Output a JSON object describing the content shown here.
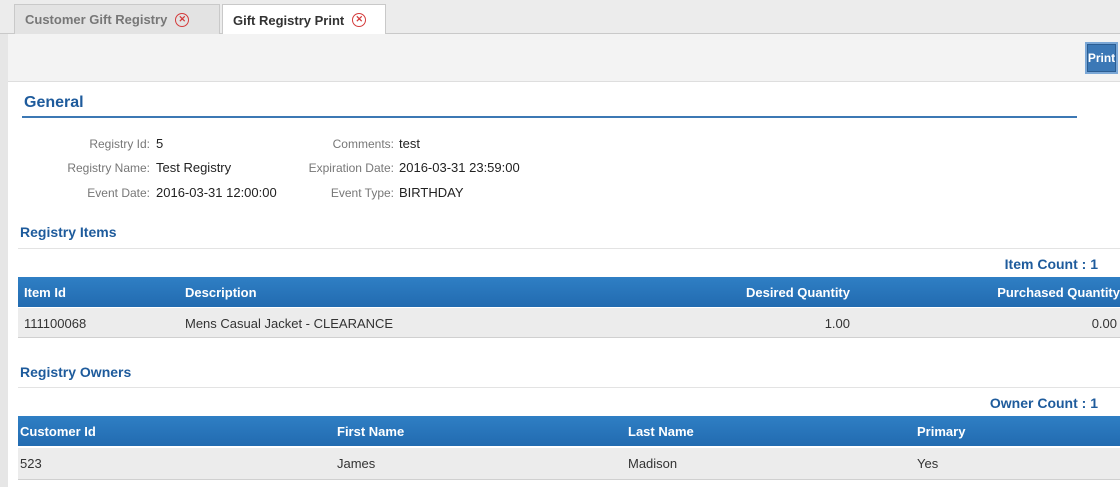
{
  "tabs": [
    {
      "label": "Customer Gift Registry",
      "active": false
    },
    {
      "label": "Gift Registry Print",
      "active": true
    }
  ],
  "toolbar": {
    "print_label": "Print"
  },
  "general": {
    "title": "General",
    "fields": {
      "registry_id": {
        "label": "Registry Id:",
        "value": "5"
      },
      "registry_name": {
        "label": "Registry Name:",
        "value": "Test Registry"
      },
      "event_date": {
        "label": "Event Date:",
        "value": "2016-03-31 12:00:00"
      },
      "comments": {
        "label": "Comments:",
        "value": "test"
      },
      "expiration_date": {
        "label": "Expiration Date:",
        "value": "2016-03-31 23:59:00"
      },
      "event_type": {
        "label": "Event Type:",
        "value": "BIRTHDAY"
      }
    }
  },
  "registry_items": {
    "title": "Registry Items",
    "count_label": "Item Count : 1",
    "columns": [
      "Item Id",
      "Description",
      "Desired Quantity",
      "Purchased Quantity"
    ],
    "rows": [
      {
        "item_id": "111100068",
        "description": "Mens Casual Jacket - CLEARANCE",
        "desired_quantity": "1.00",
        "purchased_quantity": "0.00"
      }
    ]
  },
  "registry_owners": {
    "title": "Registry Owners",
    "count_label": "Owner Count : 1",
    "columns": [
      "Customer Id",
      "First Name",
      "Last Name",
      "Primary"
    ],
    "rows": [
      {
        "customer_id": "523",
        "first_name": "James",
        "last_name": "Madison",
        "primary": "Yes"
      }
    ]
  },
  "colors": {
    "accent": "#1e5b9c",
    "header_bg": "#2a75bb",
    "row_bg": "#ececec",
    "close_icon": "#d43b3b"
  }
}
